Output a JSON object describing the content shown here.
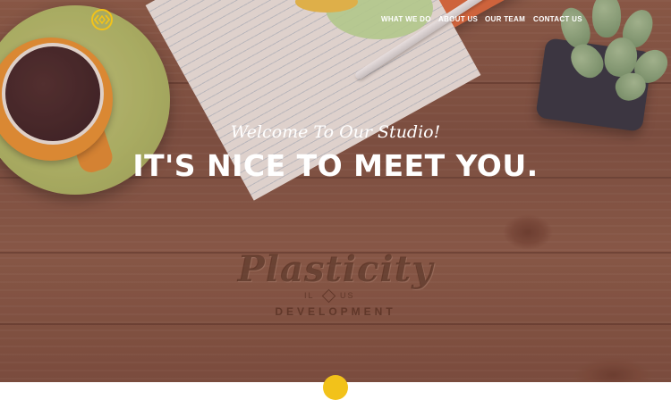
{
  "brand": {
    "logo_icon": "diamond-logo-icon",
    "accent_color": "#f2c21a"
  },
  "nav": {
    "items": [
      {
        "label": "WHAT WE DO"
      },
      {
        "label": "ABOUT US"
      },
      {
        "label": "OUR TEAM"
      },
      {
        "label": "CONTACT US"
      }
    ]
  },
  "hero": {
    "subheading": "Welcome To Our Studio!",
    "heading": "IT'S NICE TO MEET YOU.",
    "engraving": {
      "name": "Plasticity",
      "left": "IL",
      "right": "US",
      "bottom": "DEVELOPMENT"
    },
    "scroll_button_icon": "chevron-down-icon"
  }
}
